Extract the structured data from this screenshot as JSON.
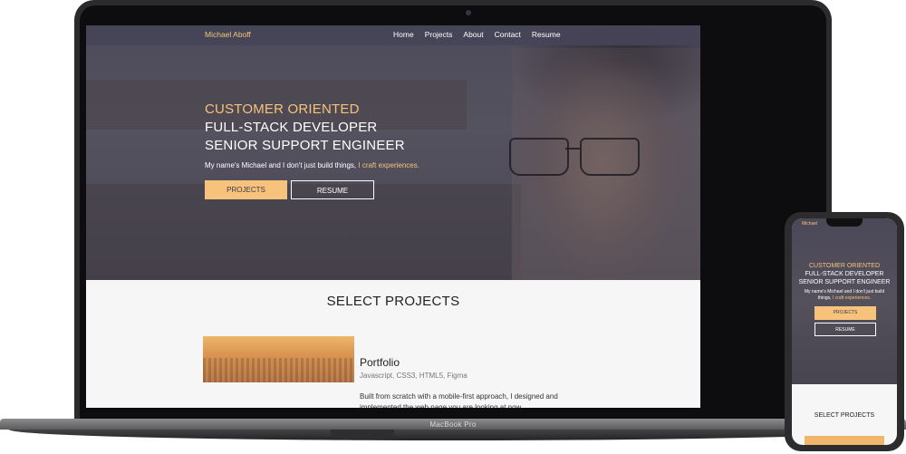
{
  "laptop": {
    "nav": {
      "brand": "Michael Aboff",
      "links": [
        "Home",
        "Projects",
        "About",
        "Contact",
        "Resume"
      ]
    },
    "hero": {
      "line1": "CUSTOMER ORIENTED",
      "line2": "FULL-STACK DEVELOPER",
      "line3": "SENIOR SUPPORT ENGINEER",
      "tagline_main": "My name's Michael and I don't just build things,",
      "tagline_highlight": "I craft experiences.",
      "btn_projects": "PROJECTS",
      "btn_resume": "RESUME"
    },
    "projects": {
      "section_title": "SELECT PROJECTS",
      "item": {
        "title": "Portfolio",
        "tech": "Javascript, CSS3, HTML5, Figma",
        "description": "Built from scratch with a mobile-first approach, I designed and implemented the web page you are looking at now"
      }
    },
    "device_label": "MacBook Pro"
  },
  "phone": {
    "brand": "Michael",
    "hero": {
      "line1": "CUSTOMER ORIENTED",
      "line2": "FULL-STACK DEVELOPER",
      "line3": "SENIOR SUPPORT ENGINEER",
      "tagline_main": "My name's Michael and I don't just build things,",
      "tagline_highlight": "I craft experiences.",
      "btn_projects": "PROJECTS",
      "btn_resume": "RESUME"
    },
    "section_title": "SELECT PROJECTS"
  },
  "colors": {
    "accent": "#f6c27c",
    "hero_overlay": "#4d4b5b",
    "device_frame": "#2b2b2d"
  }
}
